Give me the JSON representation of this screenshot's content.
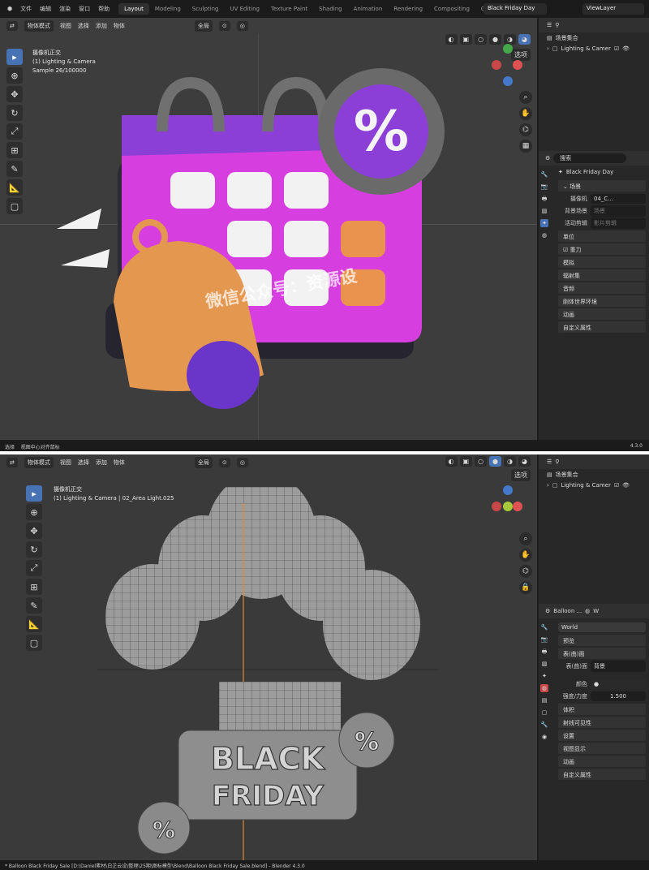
{
  "shot1": {
    "menu": [
      "文件",
      "编辑",
      "渲染",
      "窗口",
      "帮助"
    ],
    "workspace_tabs": [
      "Layout",
      "Modeling",
      "Sculpting",
      "UV Editing",
      "Texture Paint",
      "Shading",
      "Animation",
      "Rendering",
      "Compositing",
      "Geom"
    ],
    "active_tab": "Layout",
    "scene_name": "Black Friday Day",
    "view_layer": "ViewLayer",
    "viewport": {
      "mode": "物体模式",
      "menus": [
        "视图",
        "选择",
        "添加",
        "物体"
      ],
      "transform": "全局",
      "options": "选项",
      "info_line1": "摄像机正交",
      "info_line2": "(1) Lighting & Camera",
      "info_line3": "Sample 26/100000"
    },
    "outliner": {
      "collection": "场景集合",
      "item": "Lighting & Camer"
    },
    "properties": {
      "search_placeholder": "搜索",
      "scene": "Black Friday Day",
      "panel": "场景",
      "camera_label": "摄像机",
      "camera_value": "04_C...",
      "bg_label": "背景场景",
      "bg_value": "场景",
      "clip_label": "活动剪辑",
      "clip_value": "影片剪辑",
      "sections": [
        "单位",
        "重力",
        "模拟",
        "辐射集",
        "音频",
        "刚体世界环境",
        "动画",
        "自定义属性"
      ]
    },
    "watermark": "微信公众号：资源设",
    "status_left": "选择",
    "status_mid": "视图中心对齐鼠标",
    "version": "4.3.0"
  },
  "shot2": {
    "viewport": {
      "mode": "物体模式",
      "menus": [
        "视图",
        "选择",
        "添加",
        "物体"
      ],
      "transform": "全局",
      "options": "选项",
      "info_line1": "摄像机正交",
      "info_line2": "(1) Lighting & Camera | 02_Area Light.025"
    },
    "outliner": {
      "collection": "场景集合",
      "item": "Lighting & Camer"
    },
    "properties": {
      "scene": "Balloon ...",
      "world_label": "W",
      "world_name": "World",
      "sections_top": [
        "预览"
      ],
      "surface_section": "表(曲)面",
      "surface_label": "表(曲)面",
      "surface_value": "背景",
      "color_label": "颜色",
      "strength_label": "强度/力度",
      "strength_value": "1.500",
      "sections": [
        "体积",
        "射线可见性",
        "设置",
        "视图显示",
        "动画",
        "自定义属性"
      ]
    },
    "sign_line1": "BLACK",
    "sign_line2": "FRIDAY",
    "badge": "%",
    "status": "* Balloon Black Friday Sale [D:\\Daniel素材\\白芷云设\\整理\\25期\\图标模型\\Blend\\Balloon Black Friday Sale.blend] - Blender 4.3.0"
  },
  "colors": {
    "accent": "#4772b3",
    "calendar": "#d63ee0",
    "purple": "#8c3fd6",
    "bell": "#e4974f"
  }
}
